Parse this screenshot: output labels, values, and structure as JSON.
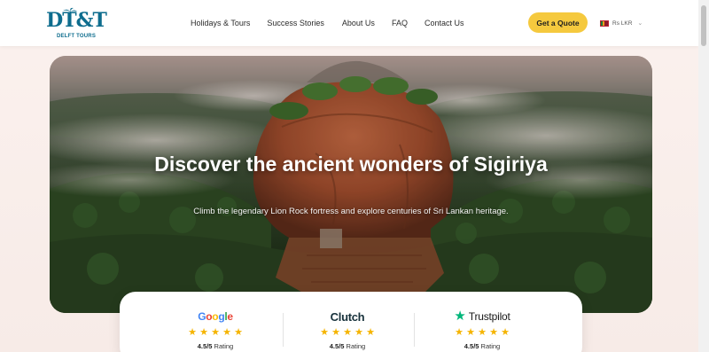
{
  "brand": {
    "logo_mark": "DT&T",
    "logo_tagline": "DELFT TOURS"
  },
  "nav": {
    "items": [
      "Holidays & Tours",
      "Success Stories",
      "About Us",
      "FAQ",
      "Contact Us"
    ]
  },
  "header": {
    "cta_label": "Get a Quote",
    "currency_label": "Rs LKR",
    "currency_flag": "flag-sri-lanka-icon"
  },
  "hero": {
    "title": "Discover the ancient wonders of Sigiriya",
    "subtitle": "Climb the legendary Lion Rock fortress and explore centuries of Sri Lankan heritage."
  },
  "ratings": [
    {
      "provider": "Google",
      "score": "4.5/5",
      "suffix": "Rating",
      "stars": 5
    },
    {
      "provider": "Clutch",
      "score": "4.5/5",
      "suffix": "Rating",
      "stars": 5
    },
    {
      "provider": "Trustpilot",
      "score": "4.5/5",
      "suffix": "Rating",
      "stars": 5
    }
  ],
  "colors": {
    "accent": "#f5c93e",
    "brand": "#0e6d8e",
    "star": "#f5b400",
    "trustpilot_green": "#00b67a"
  }
}
